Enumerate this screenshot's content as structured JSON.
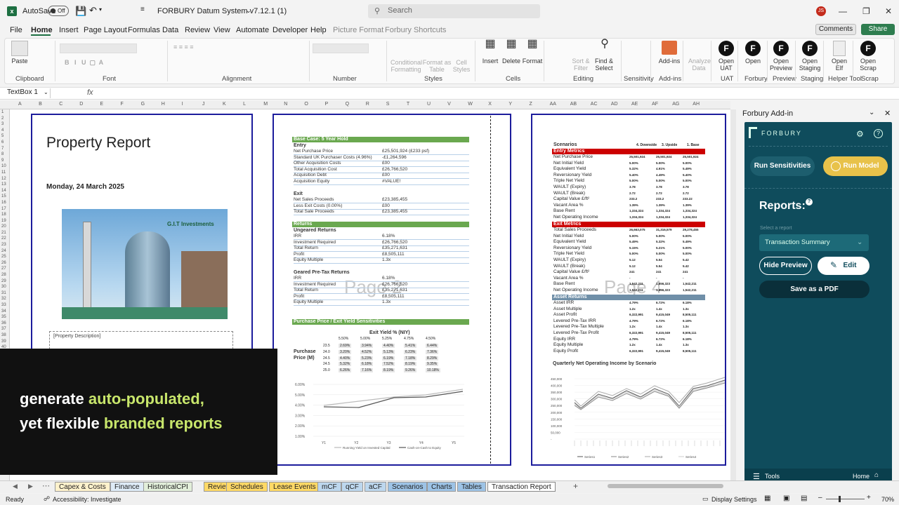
{
  "app": {
    "autosave_label": "AutoSave",
    "autosave_state": "Off",
    "doc_title": "FORBURY Datum System v7.12.1 (1)",
    "search_placeholder": "Search",
    "user_initials": "JS"
  },
  "menu": [
    "File",
    "Home",
    "Insert",
    "Page Layout",
    "Formulas",
    "Data",
    "Review",
    "View",
    "Automate",
    "Developer",
    "Help",
    "Picture Format",
    "Forbury Shortcuts"
  ],
  "menu_active": "Home",
  "comments_label": "Comments",
  "share_label": "Share",
  "ribbon": {
    "groups": [
      "Clipboard",
      "Font",
      "Alignment",
      "Number",
      "Styles",
      "Cells",
      "Editing",
      "Sensitivity",
      "Add-ins",
      "UAT",
      "Forbury",
      "Preview",
      "Staging",
      "Helper Tool",
      "Scrap"
    ],
    "paste": "Paste",
    "conditional": "Conditional Formatting",
    "format_table": "Format as Table",
    "cell_styles": "Cell Styles",
    "insert": "Insert",
    "delete": "Delete",
    "format": "Format",
    "sort": "Sort & Filter",
    "find": "Find & Select",
    "sensitivity": "Sensitivity",
    "addins": "Add-ins",
    "analyze": "Analyze Data",
    "open_uat": "Open UAT",
    "open": "Open",
    "open_preview": "Open Preview",
    "open_staging": "Open Staging",
    "open_elf": "Open Elf",
    "open_scrap": "Open Scrap"
  },
  "formula_bar": {
    "name_box": "TextBox 1",
    "fx": "fx"
  },
  "columns": [
    "A",
    "B",
    "C",
    "D",
    "E",
    "F",
    "G",
    "H",
    "I",
    "J",
    "K",
    "L",
    "M",
    "N",
    "O",
    "P",
    "Q",
    "R",
    "S",
    "T",
    "U",
    "V",
    "W",
    "X",
    "Y",
    "Z",
    "AA",
    "AB",
    "AC",
    "AD",
    "AE",
    "AF",
    "AG",
    "AH"
  ],
  "page1": {
    "title": "Property Report",
    "date": "Monday, 24 March 2025",
    "logo_text": "G.I.T Investments",
    "desc": "[Property Description]"
  },
  "page2": {
    "label": "Page 2",
    "base_case": "Base Case: 5 Year Hold",
    "entry_title": "Entry",
    "entry": [
      [
        "Net Purchase Price",
        "£25,501,924 (£233 psf)"
      ],
      [
        "Standard UK Purchaser Costs (4.96%)",
        "-£1,264,596"
      ],
      [
        "Other Acquisition Costs",
        "£00"
      ],
      [
        "Total Acquisition Cost",
        "£26,766,520"
      ],
      [
        "Acquisition Debt",
        "£00"
      ],
      [
        "Acquisition Equity",
        "#VALUE!"
      ]
    ],
    "exit_title": "Exit",
    "exit": [
      [
        "Net Sales Proceeds",
        "£23,385,455"
      ],
      [
        "Less Exit Costs (0.00%)",
        "£00"
      ],
      [
        "Total Sale Proceeds",
        "£23,385,455"
      ]
    ],
    "returns_hdr": "Returns",
    "ungeared_title": "Ungeared Returns",
    "ungeared": [
      [
        "IRR",
        "6.18%"
      ],
      [
        "Investment Required",
        "£26,766,520"
      ],
      [
        "Total Return",
        "£35,271,631"
      ],
      [
        "Profit",
        "£8,505,111"
      ],
      [
        "Equity Multiple",
        "1.3x"
      ]
    ],
    "geared_title": "Geared Pre-Tax Returns",
    "geared": [
      [
        "IRR",
        "6.18%"
      ],
      [
        "Investment Required",
        "£26,766,520"
      ],
      [
        "Total Return",
        "£35,271,631"
      ],
      [
        "Profit",
        "£8,505,111"
      ],
      [
        "Equity Multiple",
        "1.3x"
      ]
    ],
    "sens_hdr": "Purchase Price / Exit Yield Sensitivities",
    "sens_title": "Exit Yield % (NIY)",
    "sens_row_label": "Purchase Price (M)",
    "sens_cols": [
      "5.50%",
      "5.00%",
      "5.25%",
      "4.75%",
      "4.50%"
    ],
    "sens_rows": [
      [
        "23.5",
        "2.69%",
        "3.94%",
        "4.40%",
        "5.41%",
        "6.44%"
      ],
      [
        "24.0",
        "3.20%",
        "4.52%",
        "5.13%",
        "6.23%",
        "7.36%"
      ],
      [
        "24.5",
        "4.40%",
        "5.23%",
        "6.19%",
        "7.18%",
        "8.29%"
      ],
      [
        "24.5",
        "5.32%",
        "6.18%",
        "7.52%",
        "8.19%",
        "9.35%"
      ],
      [
        "25.0",
        "6.26%",
        "7.16%",
        "8.19%",
        "9.26%",
        "10.18%"
      ]
    ],
    "chart_yticks": [
      "6.00%",
      "5.00%",
      "4.00%",
      "3.00%",
      "2.00%",
      "1.00%"
    ],
    "chart_xticks": [
      "Y1",
      "Y2",
      "Y3",
      "Y4",
      "Y5"
    ],
    "chart_legend": [
      "Running Yield on Invested Capital",
      "Cash-on-Cash to Equity"
    ]
  },
  "page3": {
    "label": "Page 4",
    "scenarios_title": "Scenarios",
    "scenario_cols": [
      "4. Downside",
      "3. Upside",
      "1. Base"
    ],
    "entry_hdr": "Entry Metrics",
    "entry": [
      [
        "Net Purchase Price",
        "25,501,924",
        "25,501,924",
        "25,501,924"
      ],
      [
        "Net Initial Yield",
        "5.00%",
        "5.00%",
        "5.00%"
      ],
      [
        "Equivalent Yield",
        "5.32%",
        "4.91%",
        "5.49%"
      ],
      [
        "Reversionary Yield",
        "5.40%",
        "4.49%",
        "5.40%"
      ],
      [
        "Triple Net Yield",
        "5.00%",
        "5.00%",
        "5.00%"
      ],
      [
        "WAULT (Expiry)",
        "3.78",
        "3.78",
        "3.78"
      ],
      [
        "WAULT (Break)",
        "2.72",
        "2.72",
        "2.72"
      ],
      [
        "Capital Value £/ft²",
        "233.2",
        "233.2",
        "233.22"
      ],
      [
        "Vacant Area %",
        "1.39%",
        "1.39%",
        "1.39%"
      ],
      [
        "Base Rent",
        "1,334,324",
        "1,334,324",
        "1,334,324"
      ],
      [
        "Net Operating Income",
        "1,334,324",
        "1,334,324",
        "1,334,324"
      ]
    ],
    "exit_hdr": "Exit Metrics",
    "exit": [
      [
        "Total Sales Proceeds",
        "26,663,075",
        "31,316,579",
        "29,278,455"
      ],
      [
        "Net Initial Yield",
        "5.00%",
        "5.00%",
        "5.00%"
      ],
      [
        "Equivalent Yield",
        "5.49%",
        "5.32%",
        "5.49%"
      ],
      [
        "Reversionary Yield",
        "5.15%",
        "5.21%",
        "5.00%"
      ],
      [
        "Triple Net Yield",
        "5.00%",
        "5.00%",
        "5.00%"
      ],
      [
        "WAULT (Expiry)",
        "5.12",
        "5.54",
        "5.42"
      ],
      [
        "WAULT (Break)",
        "5.12",
        "5.54",
        "5.42"
      ],
      [
        "Capital Value £/ft²",
        "241",
        "241",
        "241"
      ],
      [
        "Vacant Area %",
        "-",
        "-",
        "-"
      ],
      [
        "Base Rent",
        "1,542,211",
        "1,656,323",
        "1,542,211"
      ],
      [
        "Net Operating Income",
        "1,542,211",
        "1,656,323",
        "1,542,211"
      ]
    ],
    "asset_hdr": "Asset Returns",
    "asset": [
      [
        "Asset IRR",
        "4.79%",
        "6.72%",
        "6.18%"
      ],
      [
        "Asset Multiple",
        "1.2x",
        "1.4x",
        "1.3x"
      ],
      [
        "Asset Profit",
        "6,322,991",
        "9,415,049",
        "8,505,111"
      ],
      [
        "Levered Pre-Tax IRR",
        "4.79%",
        "6.72%",
        "6.18%"
      ],
      [
        "Levered Pre-Tax Multiple",
        "1.2x",
        "1.4x",
        "1.3x"
      ],
      [
        "Levered Pre-Tax Profit",
        "6,322,991",
        "9,415,049",
        "8,505,111"
      ],
      [
        "Equity IRR",
        "4.79%",
        "6.72%",
        "6.18%"
      ],
      [
        "Equity Multiple",
        "1.2x",
        "1.4x",
        "1.3x"
      ],
      [
        "Equity Profit",
        "6,322,991",
        "9,415,049",
        "8,505,111"
      ]
    ],
    "chart_title": "Quarterly Net Operating Income by Scenario",
    "chart_yticks": [
      "450,000",
      "400,000",
      "350,000",
      "300,000",
      "250,000",
      "200,000",
      "150,000",
      "100,000",
      "50,000",
      "-"
    ],
    "chart_legend": [
      "Series1",
      "Series2",
      "Series3",
      "Series4"
    ]
  },
  "overlay": {
    "line1_pre": "generate ",
    "line1_hl": "auto-populated,",
    "line2_pre": "yet flexible ",
    "line2_hl": "branded reports"
  },
  "addin": {
    "title": "Forbury Add-in",
    "logo": "FORBURY",
    "run_sens": "Run Sensitivities",
    "run_model": "Run Model",
    "reports_label": "Reports:",
    "select_hint": "Select a report",
    "selected_report": "Transaction Summary",
    "hide_preview": "Hide Preview",
    "edit": "Edit",
    "save_pdf": "Save as a PDF",
    "tools": "Tools",
    "home": "Home"
  },
  "tabs": [
    "Capex & Costs",
    "Finance",
    "HistoricalCPI",
    "Review",
    "Schedules",
    "Lease Events",
    "mCF",
    "qCF",
    "aCF",
    "Scenarios",
    "Charts",
    "Tables",
    "Transaction Report"
  ],
  "tab_colors": [
    "#fff2cc",
    "#deebf7",
    "#e2efda",
    "#ffd966",
    "#ffd966",
    "#ffd966",
    "#bdd7ee",
    "#bdd7ee",
    "#bdd7ee",
    "#9dc3e6",
    "#9dc3e6",
    "#9dc3e6",
    "#ffffff"
  ],
  "active_tab": "Transaction Report",
  "status": {
    "ready": "Ready",
    "accessibility": "Accessibility: Investigate",
    "display": "Display Settings",
    "zoom": "70%"
  }
}
